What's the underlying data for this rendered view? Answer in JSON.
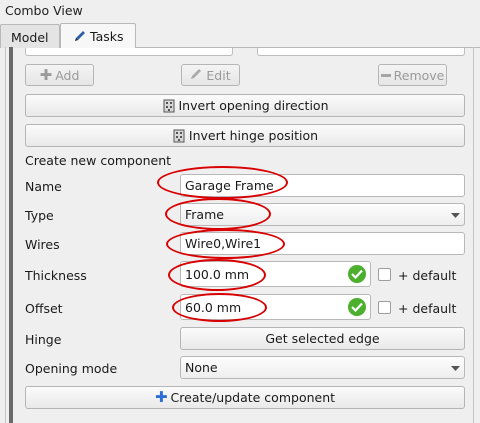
{
  "window": {
    "title": "Combo View"
  },
  "tabs": [
    {
      "label": "Model"
    },
    {
      "label": "Tasks"
    }
  ],
  "toolbar": {
    "add": "Add",
    "edit": "Edit",
    "remove": "Remove"
  },
  "buttons": {
    "invert_opening": "Invert opening direction",
    "invert_hinge": "Invert hinge position",
    "get_edge": "Get selected edge",
    "create_update": "Create/update component"
  },
  "form": {
    "section": "Create new component",
    "name": {
      "label": "Name",
      "value": "Garage Frame"
    },
    "type": {
      "label": "Type",
      "value": "Frame"
    },
    "wires": {
      "label": "Wires",
      "value": "Wire0,Wire1"
    },
    "thickness": {
      "label": "Thickness",
      "value": "100.0 mm",
      "default_label": "+ default"
    },
    "offset": {
      "label": "Offset",
      "value": "60.0 mm",
      "default_label": "+ default"
    },
    "hinge": {
      "label": "Hinge"
    },
    "opening_mode": {
      "label": "Opening mode",
      "value": "None"
    }
  },
  "colors": {
    "annotation": "#d80000",
    "valid": "#4caf2e"
  },
  "icons": {
    "tasks_tab": "pencil-icon",
    "invert": "hinge-icon",
    "add": "plus-icon",
    "edit": "edit-icon",
    "remove": "minus-icon",
    "valid": "check-icon",
    "dropdown": "chevron-down-icon"
  }
}
